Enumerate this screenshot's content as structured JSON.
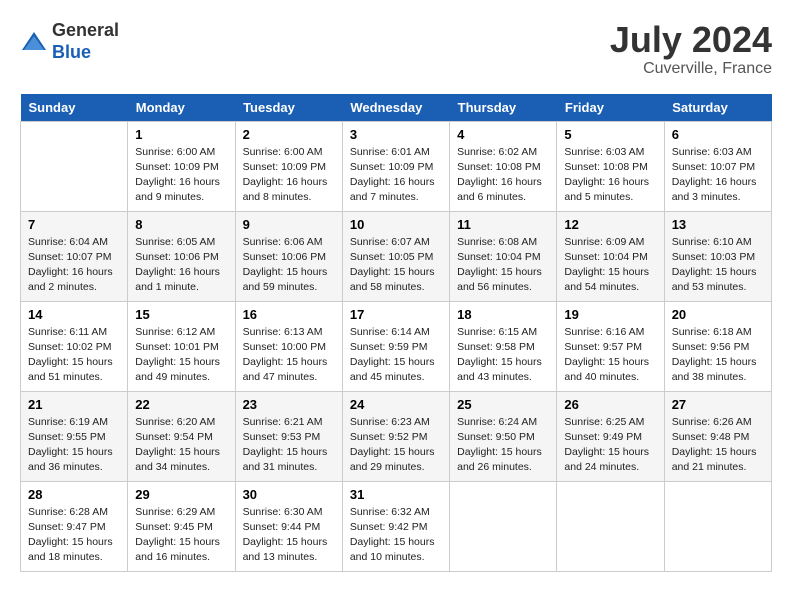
{
  "header": {
    "logo_general": "General",
    "logo_blue": "Blue",
    "title": "July 2024",
    "location": "Cuverville, France"
  },
  "columns": [
    "Sunday",
    "Monday",
    "Tuesday",
    "Wednesday",
    "Thursday",
    "Friday",
    "Saturday"
  ],
  "weeks": [
    [
      {
        "day": "",
        "content": ""
      },
      {
        "day": "1",
        "content": "Sunrise: 6:00 AM\nSunset: 10:09 PM\nDaylight: 16 hours\nand 9 minutes."
      },
      {
        "day": "2",
        "content": "Sunrise: 6:00 AM\nSunset: 10:09 PM\nDaylight: 16 hours\nand 8 minutes."
      },
      {
        "day": "3",
        "content": "Sunrise: 6:01 AM\nSunset: 10:09 PM\nDaylight: 16 hours\nand 7 minutes."
      },
      {
        "day": "4",
        "content": "Sunrise: 6:02 AM\nSunset: 10:08 PM\nDaylight: 16 hours\nand 6 minutes."
      },
      {
        "day": "5",
        "content": "Sunrise: 6:03 AM\nSunset: 10:08 PM\nDaylight: 16 hours\nand 5 minutes."
      },
      {
        "day": "6",
        "content": "Sunrise: 6:03 AM\nSunset: 10:07 PM\nDaylight: 16 hours\nand 3 minutes."
      }
    ],
    [
      {
        "day": "7",
        "content": "Sunrise: 6:04 AM\nSunset: 10:07 PM\nDaylight: 16 hours\nand 2 minutes."
      },
      {
        "day": "8",
        "content": "Sunrise: 6:05 AM\nSunset: 10:06 PM\nDaylight: 16 hours\nand 1 minute."
      },
      {
        "day": "9",
        "content": "Sunrise: 6:06 AM\nSunset: 10:06 PM\nDaylight: 15 hours\nand 59 minutes."
      },
      {
        "day": "10",
        "content": "Sunrise: 6:07 AM\nSunset: 10:05 PM\nDaylight: 15 hours\nand 58 minutes."
      },
      {
        "day": "11",
        "content": "Sunrise: 6:08 AM\nSunset: 10:04 PM\nDaylight: 15 hours\nand 56 minutes."
      },
      {
        "day": "12",
        "content": "Sunrise: 6:09 AM\nSunset: 10:04 PM\nDaylight: 15 hours\nand 54 minutes."
      },
      {
        "day": "13",
        "content": "Sunrise: 6:10 AM\nSunset: 10:03 PM\nDaylight: 15 hours\nand 53 minutes."
      }
    ],
    [
      {
        "day": "14",
        "content": "Sunrise: 6:11 AM\nSunset: 10:02 PM\nDaylight: 15 hours\nand 51 minutes."
      },
      {
        "day": "15",
        "content": "Sunrise: 6:12 AM\nSunset: 10:01 PM\nDaylight: 15 hours\nand 49 minutes."
      },
      {
        "day": "16",
        "content": "Sunrise: 6:13 AM\nSunset: 10:00 PM\nDaylight: 15 hours\nand 47 minutes."
      },
      {
        "day": "17",
        "content": "Sunrise: 6:14 AM\nSunset: 9:59 PM\nDaylight: 15 hours\nand 45 minutes."
      },
      {
        "day": "18",
        "content": "Sunrise: 6:15 AM\nSunset: 9:58 PM\nDaylight: 15 hours\nand 43 minutes."
      },
      {
        "day": "19",
        "content": "Sunrise: 6:16 AM\nSunset: 9:57 PM\nDaylight: 15 hours\nand 40 minutes."
      },
      {
        "day": "20",
        "content": "Sunrise: 6:18 AM\nSunset: 9:56 PM\nDaylight: 15 hours\nand 38 minutes."
      }
    ],
    [
      {
        "day": "21",
        "content": "Sunrise: 6:19 AM\nSunset: 9:55 PM\nDaylight: 15 hours\nand 36 minutes."
      },
      {
        "day": "22",
        "content": "Sunrise: 6:20 AM\nSunset: 9:54 PM\nDaylight: 15 hours\nand 34 minutes."
      },
      {
        "day": "23",
        "content": "Sunrise: 6:21 AM\nSunset: 9:53 PM\nDaylight: 15 hours\nand 31 minutes."
      },
      {
        "day": "24",
        "content": "Sunrise: 6:23 AM\nSunset: 9:52 PM\nDaylight: 15 hours\nand 29 minutes."
      },
      {
        "day": "25",
        "content": "Sunrise: 6:24 AM\nSunset: 9:50 PM\nDaylight: 15 hours\nand 26 minutes."
      },
      {
        "day": "26",
        "content": "Sunrise: 6:25 AM\nSunset: 9:49 PM\nDaylight: 15 hours\nand 24 minutes."
      },
      {
        "day": "27",
        "content": "Sunrise: 6:26 AM\nSunset: 9:48 PM\nDaylight: 15 hours\nand 21 minutes."
      }
    ],
    [
      {
        "day": "28",
        "content": "Sunrise: 6:28 AM\nSunset: 9:47 PM\nDaylight: 15 hours\nand 18 minutes."
      },
      {
        "day": "29",
        "content": "Sunrise: 6:29 AM\nSunset: 9:45 PM\nDaylight: 15 hours\nand 16 minutes."
      },
      {
        "day": "30",
        "content": "Sunrise: 6:30 AM\nSunset: 9:44 PM\nDaylight: 15 hours\nand 13 minutes."
      },
      {
        "day": "31",
        "content": "Sunrise: 6:32 AM\nSunset: 9:42 PM\nDaylight: 15 hours\nand 10 minutes."
      },
      {
        "day": "",
        "content": ""
      },
      {
        "day": "",
        "content": ""
      },
      {
        "day": "",
        "content": ""
      }
    ]
  ]
}
